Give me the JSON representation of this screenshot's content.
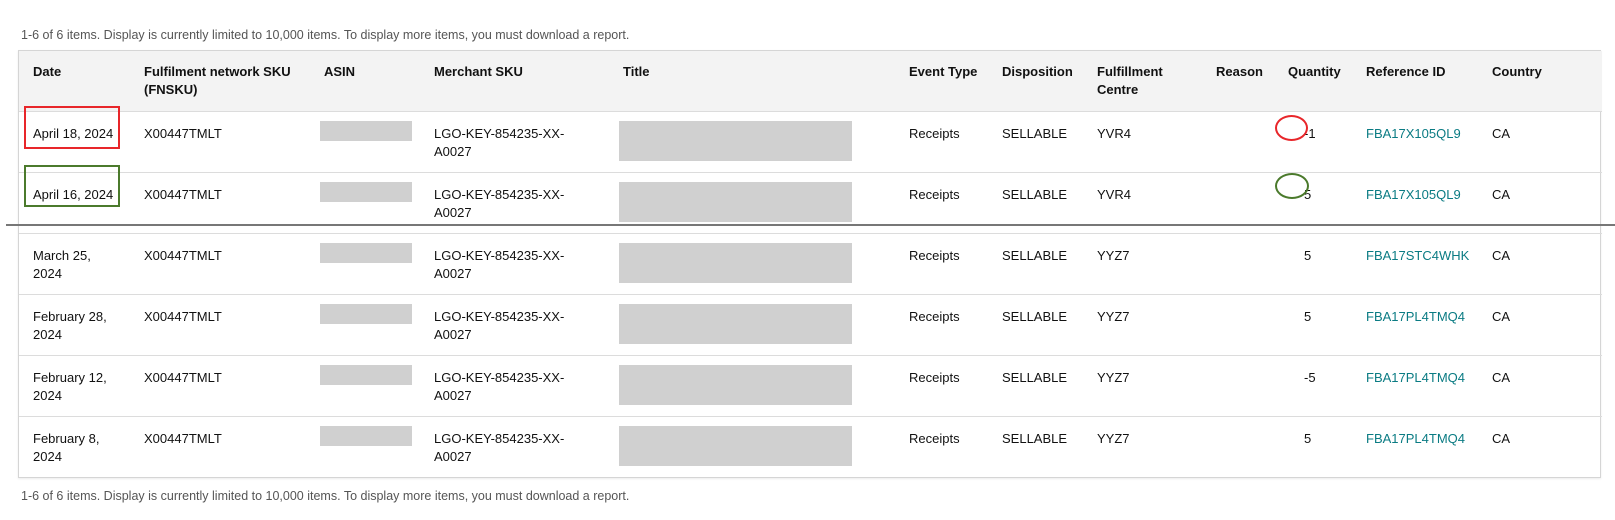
{
  "summary_text": "1-6 of 6 items. Display is currently limited to 10,000 items. To display more items, you must download a report.",
  "columns": {
    "date": "Date",
    "fnsku": "Fulfilment network SKU (FNSKU)",
    "asin": "ASIN",
    "merchant_sku": "Merchant SKU",
    "title": "Title",
    "event_type": "Event Type",
    "disposition": "Disposition",
    "fulfillment_centre": "Fulfillment Centre",
    "reason": "Reason",
    "quantity": "Quantity",
    "reference_id": "Reference ID",
    "country": "Country"
  },
  "rows": [
    {
      "date": "April 18, 2024",
      "fnsku": "X00447TMLT",
      "merchant_sku": "LGO-KEY-854235-XX-A0027",
      "event_type": "Receipts",
      "disposition": "SELLABLE",
      "fulfillment_centre": "YVR4",
      "reason": "",
      "quantity": "-1",
      "reference_id": "FBA17X105QL9",
      "country": "CA"
    },
    {
      "date": "April 16, 2024",
      "fnsku": "X00447TMLT",
      "merchant_sku": "LGO-KEY-854235-XX-A0027",
      "event_type": "Receipts",
      "disposition": "SELLABLE",
      "fulfillment_centre": "YVR4",
      "reason": "",
      "quantity": "5",
      "reference_id": "FBA17X105QL9",
      "country": "CA"
    },
    {
      "date": "March 25, 2024",
      "fnsku": "X00447TMLT",
      "merchant_sku": "LGO-KEY-854235-XX-A0027",
      "event_type": "Receipts",
      "disposition": "SELLABLE",
      "fulfillment_centre": "YYZ7",
      "reason": "",
      "quantity": "5",
      "reference_id": "FBA17STC4WHK",
      "country": "CA"
    },
    {
      "date": "February 28, 2024",
      "fnsku": "X00447TMLT",
      "merchant_sku": "LGO-KEY-854235-XX-A0027",
      "event_type": "Receipts",
      "disposition": "SELLABLE",
      "fulfillment_centre": "YYZ7",
      "reason": "",
      "quantity": "5",
      "reference_id": "FBA17PL4TMQ4",
      "country": "CA"
    },
    {
      "date": "February 12, 2024",
      "fnsku": "X00447TMLT",
      "merchant_sku": "LGO-KEY-854235-XX-A0027",
      "event_type": "Receipts",
      "disposition": "SELLABLE",
      "fulfillment_centre": "YYZ7",
      "reason": "",
      "quantity": "-5",
      "reference_id": "FBA17PL4TMQ4",
      "country": "CA"
    },
    {
      "date": "February 8, 2024",
      "fnsku": "X00447TMLT",
      "merchant_sku": "LGO-KEY-854235-XX-A0027",
      "event_type": "Receipts",
      "disposition": "SELLABLE",
      "fulfillment_centre": "YYZ7",
      "reason": "",
      "quantity": "5",
      "reference_id": "FBA17PL4TMQ4",
      "country": "CA"
    }
  ],
  "colors": {
    "link": "#0a7b83",
    "annotation_red": "#e8262a",
    "annotation_green": "#4b7a2c",
    "redaction": "#d0d0d0"
  }
}
